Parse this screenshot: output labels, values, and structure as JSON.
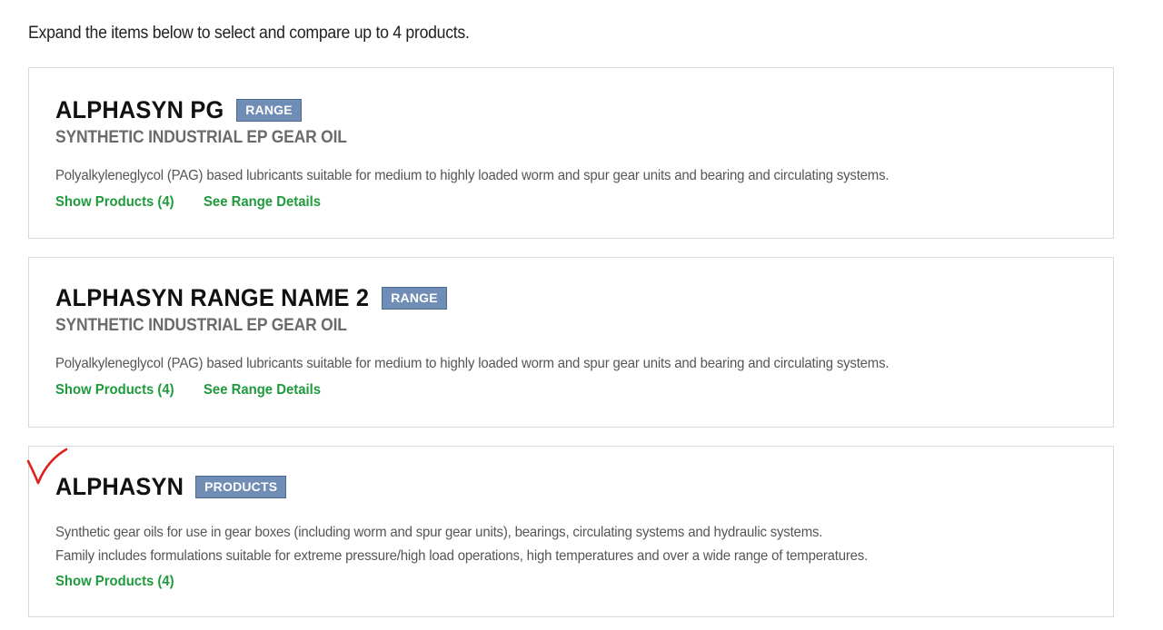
{
  "intro": {
    "text": "Expand the items below to select and compare up to 4 products."
  },
  "cards": [
    {
      "title": "ALPHASYN PG",
      "badge": "RANGE",
      "subtitle": "SYNTHETIC INDUSTRIAL EP GEAR OIL",
      "description": "Polyalkyleneglycol (PAG) based lubricants suitable for medium to highly loaded worm and spur gear units and bearing and circulating systems.",
      "show_products": "Show Products (4)",
      "see_details": "See Range Details"
    },
    {
      "title": "ALPHASYN RANGE NAME 2",
      "badge": "RANGE",
      "subtitle": "SYNTHETIC INDUSTRIAL EP GEAR OIL",
      "description": "Polyalkyleneglycol (PAG) based lubricants suitable for medium to highly loaded worm and spur gear units and bearing and circulating systems.",
      "show_products": "Show Products (4)",
      "see_details": "See Range Details"
    },
    {
      "title": "ALPHASYN",
      "badge": "PRODUCTS",
      "description_line1": "Synthetic gear oils for use in gear boxes (including worm and spur gear units), bearings, circulating systems and hydraulic systems.",
      "description_line2": "Family includes formulations suitable for extreme pressure/high load operations, high temperatures and over a wide range of temperatures.",
      "show_products": "Show Products (4)"
    }
  ],
  "colors": {
    "badge_bg": "#6f8db5",
    "link": "#1f9a3c",
    "annotation_mark": "#e0201c"
  },
  "icons": {
    "annotation": "red-checkmark-icon"
  }
}
